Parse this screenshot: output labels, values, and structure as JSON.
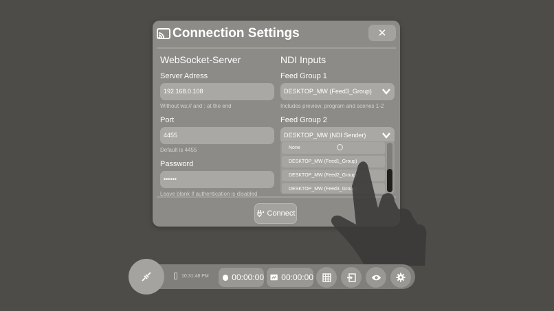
{
  "dialog": {
    "title": "Connection Settings",
    "close_label": "✕",
    "connect_label": "Connect"
  },
  "websocket": {
    "heading": "WebSocket-Server",
    "server_label": "Server Adress",
    "server_value": "192.168.0.108",
    "server_hint": "Without ws:// and : at the end",
    "port_label": "Port",
    "port_value": "4455",
    "port_hint": "Default is 4455",
    "password_label": "Password",
    "password_value": "••••••",
    "password_hint": "Leave blank if authentication is disabled"
  },
  "ndi": {
    "heading": "NDI Inputs",
    "group1_label": "Feed  Group 1",
    "group1_value": "DESKTOP_MW (Feed3_Group)",
    "group1_hint": "Includes preview, program and scenes 1-2",
    "group2_label": "Feed Group 2",
    "group2_value": "DESKTOP_MW (NDI Sender)",
    "options": [
      "None",
      "DESKTOP_MW (Feed1_Group)",
      "DESKTOP_MW (Feed2_Group)",
      "DESKTOP_MW (Feed3_Group)"
    ]
  },
  "toolbar": {
    "clock": "10:31:48 PM",
    "record_time": "00:00:00",
    "stream_time": "00:00:00",
    "icons": [
      "disconnect-icon",
      "battery-icon",
      "record-icon",
      "stream-icon",
      "grid-icon",
      "enter-icon",
      "eye-icon",
      "gear-icon"
    ]
  }
}
